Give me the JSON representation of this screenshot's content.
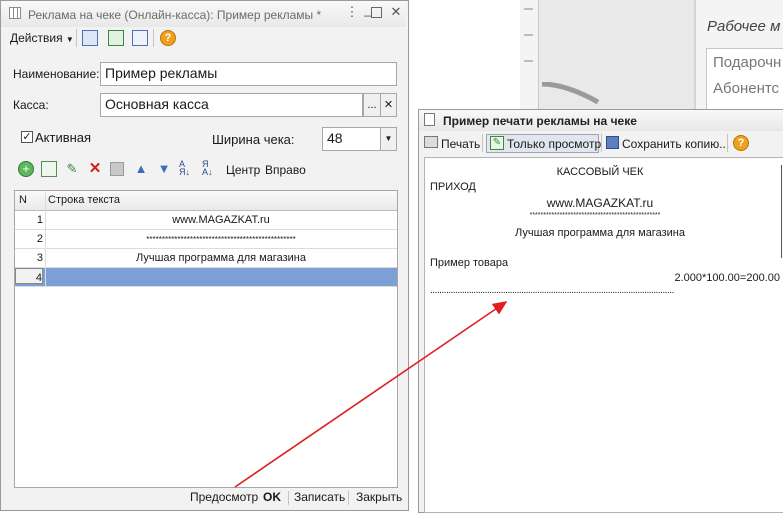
{
  "left_window": {
    "title": "Реклама на чеке (Онлайн-касса): Пример рекламы *",
    "toolbar": {
      "actions_label": "Действия"
    },
    "form": {
      "name_label": "Наименование:",
      "name_value": "Пример рекламы",
      "cash_label": "Касса:",
      "cash_value": "Основная касса",
      "cash_select_label": "...",
      "cash_clear_label": "✕",
      "active_label": "Активная",
      "width_label": "Ширина чека:",
      "width_value": "48"
    },
    "table_toolbar": {
      "center_label": "Центр",
      "right_label": "Вправо"
    },
    "table": {
      "headers": [
        "N",
        "Строка текста"
      ],
      "rows": [
        {
          "n": "1",
          "text": "www.MAGAZKAT.ru"
        },
        {
          "n": "2",
          "text": "************************************************"
        },
        {
          "n": "3",
          "text": "Лучшая программа для магазина"
        },
        {
          "n": "4",
          "text": ""
        }
      ]
    },
    "footer": {
      "preview_label": "Предосмотр",
      "ok_label": "OK",
      "save_label": "Записать",
      "close_label": "Закрыть"
    }
  },
  "right_window": {
    "title": "Пример печати рекламы на чеке",
    "toolbar": {
      "print_label": "Печать",
      "view_only_label": "Только просмотр",
      "save_copy_label": "Сохранить копию..."
    },
    "receipt": {
      "heading": "КАССОВЫЙ ЧЕК",
      "type": "ПРИХОД",
      "ad_line1": "www.MAGAZKAT.ru",
      "ad_line2": "************************************************",
      "ad_line3": "Лучшая программа для магазина",
      "item_name": "Пример товара",
      "item_calc": "2.000*100.00=200.00",
      "separator": "..........................................................................................................."
    }
  },
  "background_window": {
    "title": "Рабочее м",
    "items": [
      "Подарочн",
      "Абонентс"
    ]
  },
  "colors": {
    "selected_row": "#7e9fd6",
    "arrow": "#e02020",
    "help_icon": "#f0a020"
  }
}
